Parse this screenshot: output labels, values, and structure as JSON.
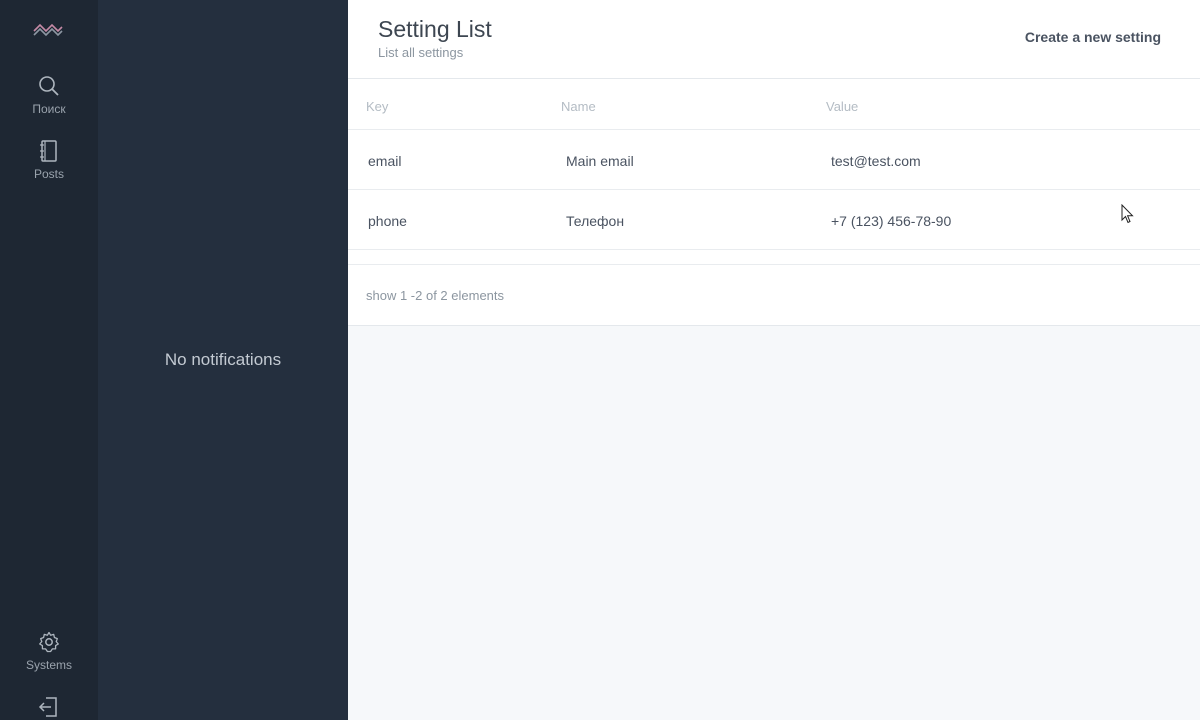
{
  "rail": {
    "logo_icon": "wave-logo-icon",
    "items": [
      {
        "label": "Поиск",
        "icon": "search-icon"
      },
      {
        "label": "Posts",
        "icon": "notebook-icon"
      }
    ],
    "bottom": [
      {
        "label": "Systems",
        "icon": "gear-icon"
      },
      {
        "label": "",
        "icon": "logout-icon"
      }
    ]
  },
  "notifications": {
    "empty_text": "No notifications"
  },
  "header": {
    "title": "Setting List",
    "subtitle": "List all settings",
    "create_label": "Create a new setting"
  },
  "table": {
    "columns": [
      "Key",
      "Name",
      "Value"
    ],
    "rows": [
      {
        "key": "email",
        "name": "Main email",
        "value": "test@test.com"
      },
      {
        "key": "phone",
        "name": "Телефон",
        "value": "+7 (123) 456-78-90"
      }
    ],
    "footer": "show 1 -2 of 2 elements"
  },
  "colors": {
    "rail_bg": "#1e2733",
    "panel_bg": "#242f3e",
    "main_bg": "#f6f8fa",
    "logo_accent": "#c58aa6"
  }
}
